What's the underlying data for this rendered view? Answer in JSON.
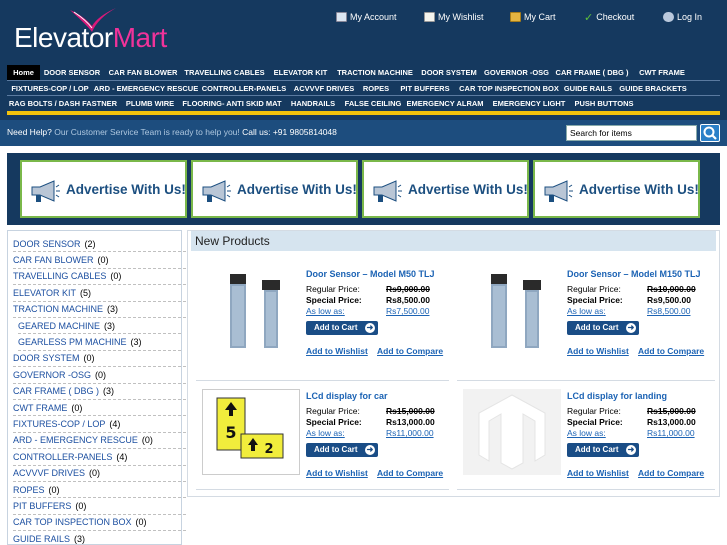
{
  "brand": {
    "part1": "Elevator",
    "part2": "Mart",
    "swoosh_color": "#d9197a"
  },
  "colors": {
    "header_bg": "#15395f",
    "help_bg": "#1d4d7e",
    "accent_yellow": "#f2c20c",
    "link_blue": "#1c63b4",
    "ad_border": "#7ab84a"
  },
  "top_links": [
    {
      "icon": "account-card-icon",
      "label": "My Account"
    },
    {
      "icon": "wishlist-note-icon",
      "label": "My Wishlist"
    },
    {
      "icon": "cart-box-icon",
      "label": "My Cart"
    },
    {
      "icon": "checkmark-icon",
      "label": "Checkout"
    },
    {
      "icon": "login-person-icon",
      "label": "Log In"
    }
  ],
  "nav": {
    "row1": [
      "Home",
      "DOOR SENSOR",
      "CAR FAN BLOWER",
      "TRAVELLING CABLES",
      "ELEVATOR KIT",
      "TRACTION MACHINE",
      "DOOR SYSTEM",
      "GOVERNOR -OSG",
      "CAR FRAME ( DBG )",
      "CWT FRAME"
    ],
    "row2": [
      "FIXTURES-COP / LOP",
      "ARD - EMERGENCY RESCUE",
      "CONTROLLER-PANELS",
      "ACVVVF DRIVES",
      "ROPES",
      "PIT BUFFERS",
      "CAR TOP INSPECTION BOX",
      "GUIDE RAILS",
      "GUIDE BRACKETS"
    ],
    "row3": [
      "RAG BOLTS / DASH FASTNER",
      "PLUMB WIRE",
      "FLOORING- ANTI SKID MAT",
      "HANDRAILS",
      "FALSE CEILING",
      "EMERGENCY ALRAM",
      "EMERGENCY LIGHT",
      "PUSH BUTTONS"
    ]
  },
  "help": {
    "need": "Need Help?",
    "sub": " Our Customer Service Team is ready to help you!",
    "call": " Call us: +91 9805814048"
  },
  "search": {
    "placeholder": "Search for items",
    "icon": "magnifier-icon"
  },
  "ads": [
    "Advertise With Us!",
    "Advertise With Us!",
    "Advertise With Us!",
    "Advertise With Us!"
  ],
  "sidebar": {
    "items": [
      {
        "name": "DOOR SENSOR",
        "count": "(2)"
      },
      {
        "name": "CAR FAN BLOWER",
        "count": "(0)"
      },
      {
        "name": "TRAVELLING CABLES",
        "count": "(0)"
      },
      {
        "name": "ELEVATOR KIT",
        "count": "(5)"
      },
      {
        "name": "TRACTION MACHINE",
        "count": "(3)"
      },
      {
        "name": "GEARED MACHINE",
        "count": "(3)"
      },
      {
        "name": "GEARLESS PM MACHINE",
        "count": "(3)"
      },
      {
        "name": "DOOR SYSTEM",
        "count": "(0)"
      },
      {
        "name": "GOVERNOR -OSG",
        "count": "(0)"
      },
      {
        "name": "CAR FRAME ( DBG )",
        "count": "(3)"
      },
      {
        "name": "CWT FRAME",
        "count": "(0)"
      },
      {
        "name": "FIXTURES-COP / LOP",
        "count": "(4)"
      },
      {
        "name": "ARD - EMERGENCY RESCUE",
        "count": "(0)"
      },
      {
        "name": "CONTROLLER-PANELS",
        "count": "(4)"
      },
      {
        "name": "ACVVVF DRIVES",
        "count": "(0)"
      },
      {
        "name": "ROPES",
        "count": "(0)"
      },
      {
        "name": "PIT BUFFERS",
        "count": "(0)"
      },
      {
        "name": "CAR TOP INSPECTION BOX",
        "count": "(0)"
      },
      {
        "name": "GUIDE RAILS",
        "count": "(3)"
      }
    ]
  },
  "main": {
    "heading": "New Products",
    "labels": {
      "regular": "Regular Price:",
      "special": "Special Price:",
      "as_low": "As low as:",
      "add_cart": "Add to Cart",
      "wishlist": "Add to Wishlist",
      "compare": "Add to Compare"
    },
    "products": [
      {
        "name": "Door Sensor – Model M50 TLJ",
        "regular": "Rs9,000.00",
        "special": "Rs8,500.00",
        "as_low": "Rs7,500.00",
        "image": "door-sensor"
      },
      {
        "name": "Door Sensor – Model M150 TLJ",
        "regular": "Rs10,000.00",
        "special": "Rs9,500.00",
        "as_low": "Rs8,500.00",
        "image": "door-sensor"
      },
      {
        "name": "LCd display for car",
        "regular": "Rs15,000.00",
        "special": "Rs13,000.00",
        "as_low": "Rs11,000.00",
        "image": "lcd-display",
        "display_digits": [
          "5",
          "2"
        ]
      },
      {
        "name": "LCd display for landing",
        "regular": "Rs15,000.00",
        "special": "Rs13,000.00",
        "as_low": "Rs11,000.00",
        "image": "placeholder-logo"
      }
    ]
  }
}
